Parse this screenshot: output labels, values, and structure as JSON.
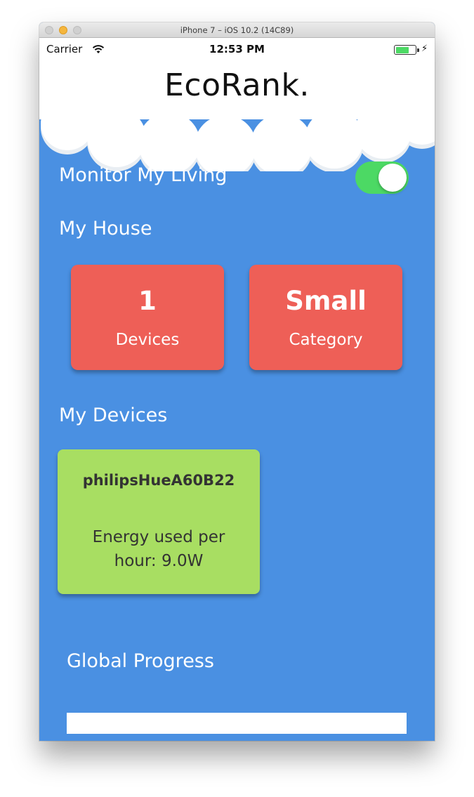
{
  "window": {
    "title": "iPhone 7 – iOS 10.2 (14C89)"
  },
  "status_bar": {
    "carrier": "Carrier",
    "time": "12:53 PM",
    "battery_level": 0.7
  },
  "app": {
    "title": "EcoRank."
  },
  "monitor": {
    "label": "Monitor My Living",
    "enabled": true
  },
  "house": {
    "heading": "My House",
    "cards": [
      {
        "value": "1",
        "caption": "Devices"
      },
      {
        "value": "Small",
        "caption": "Category"
      }
    ]
  },
  "devices": {
    "heading": "My Devices",
    "items": [
      {
        "name": "philipsHueA60B22",
        "energy": "Energy used per hour: 9.0W"
      }
    ]
  },
  "global_progress": {
    "heading": "Global Progress"
  },
  "colors": {
    "background": "#4a90e2",
    "card_red": "#ee5f57",
    "device_green": "#a8de62",
    "toggle_on": "#4cd964"
  }
}
